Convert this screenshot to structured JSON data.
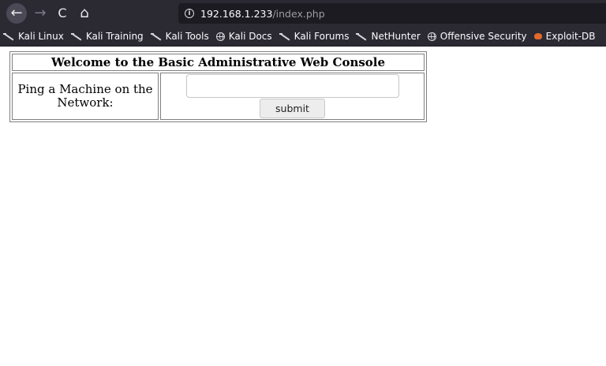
{
  "browser": {
    "nav": {
      "back_glyph": "←",
      "forward_glyph": "→",
      "reload_glyph": "C",
      "home_glyph": "⌂"
    },
    "url": {
      "host": "192.168.1.233",
      "path": "/index.php"
    },
    "bookmarks": [
      {
        "label": "Kali Linux",
        "icon": "kali-dragon-icon"
      },
      {
        "label": "Kali Training",
        "icon": "kali-dragon-icon"
      },
      {
        "label": "Kali Tools",
        "icon": "kali-dragon-icon"
      },
      {
        "label": "Kali Docs",
        "icon": "globe-icon"
      },
      {
        "label": "Kali Forums",
        "icon": "kali-dragon-icon"
      },
      {
        "label": "NetHunter",
        "icon": "kali-dragon-icon"
      },
      {
        "label": "Offensive Security",
        "icon": "globe-icon"
      },
      {
        "label": "Exploit-DB",
        "icon": "exploit-db-icon"
      }
    ],
    "colors": {
      "chrome_bg": "#2b2a33",
      "url_bg": "#1c1b22",
      "exploit_icon": "#e2692c"
    }
  },
  "page": {
    "title": "Welcome to the Basic Administrative Web Console",
    "ping_label": "Ping a Machine on the Network:",
    "ping_input_value": "",
    "submit_label": "submit"
  }
}
